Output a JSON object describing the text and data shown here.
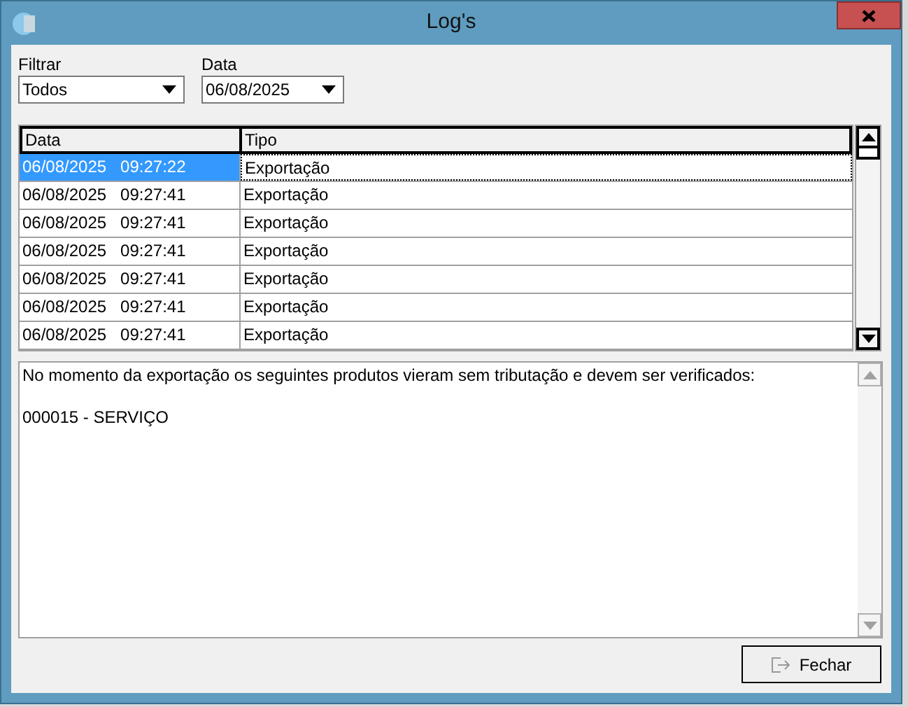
{
  "window": {
    "title": "Log's"
  },
  "filters": [
    {
      "label": "Filtrar",
      "value": "Todos"
    },
    {
      "label": "Data",
      "value": "06/08/2025"
    }
  ],
  "table": {
    "columns": [
      "Data",
      "Tipo"
    ],
    "rows": [
      {
        "cells": [
          "06/08/2025   09:27:22",
          "Exportação"
        ],
        "selected": true
      },
      {
        "cells": [
          "06/08/2025   09:27:41",
          "Exportação"
        ],
        "selected": false
      },
      {
        "cells": [
          "06/08/2025   09:27:41",
          "Exportação"
        ],
        "selected": false
      },
      {
        "cells": [
          "06/08/2025   09:27:41",
          "Exportação"
        ],
        "selected": false
      },
      {
        "cells": [
          "06/08/2025   09:27:41",
          "Exportação"
        ],
        "selected": false
      },
      {
        "cells": [
          "06/08/2025   09:27:41",
          "Exportação"
        ],
        "selected": false
      },
      {
        "cells": [
          "06/08/2025   09:27:41",
          "Exportação"
        ],
        "selected": false
      }
    ]
  },
  "details": {
    "message": "No momento da exportação os seguintes produtos vieram sem tributação e devem ser verificados:",
    "products": [
      "000015 - SERVIÇO"
    ]
  },
  "buttons": [
    {
      "label": "Fechar"
    }
  ]
}
